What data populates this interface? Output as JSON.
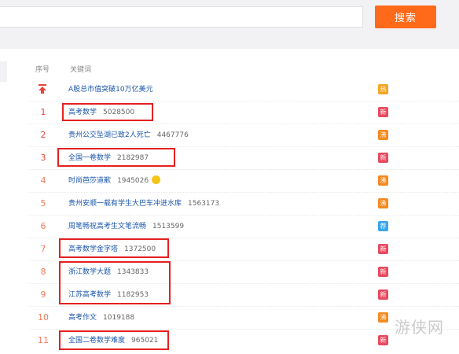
{
  "search": {
    "button_label": "搜索",
    "placeholder": ""
  },
  "table": {
    "col_num": "序号",
    "col_keyword": "关键词",
    "rows": [
      {
        "num": "",
        "keyword": "A股总市值突破10万亿美元",
        "count": "",
        "badge": "热",
        "badge_color": "#f5a623"
      },
      {
        "num": "1",
        "keyword": "高考数学",
        "count": "5028500",
        "badge": "新",
        "badge_color": "#e84a5f"
      },
      {
        "num": "2",
        "keyword": "贵州公交坠湖已致2人死亡",
        "count": "4467776",
        "badge": "沸",
        "badge_color": "#f58a1f"
      },
      {
        "num": "3",
        "keyword": "全国一卷数学",
        "count": "2182987",
        "badge": "新",
        "badge_color": "#e84a5f"
      },
      {
        "num": "4",
        "keyword": "时尚芭莎道歉",
        "count": "1945026",
        "badge": "沸",
        "badge_color": "#f58a1f"
      },
      {
        "num": "5",
        "keyword": "贵州安顺一载有学生大巴车冲进水库",
        "count": "1563173",
        "badge": "沸",
        "badge_color": "#f58a1f"
      },
      {
        "num": "6",
        "keyword": "周笔畅祝高考生文笔流畅",
        "count": "1513599",
        "badge": "荐",
        "badge_color": "#3aa6ea"
      },
      {
        "num": "7",
        "keyword": "高考数学金字塔",
        "count": "1372500",
        "badge": "新",
        "badge_color": "#e84a5f"
      },
      {
        "num": "8",
        "keyword": "浙江数学大题",
        "count": "1343833",
        "badge": "新",
        "badge_color": "#e84a5f"
      },
      {
        "num": "9",
        "keyword": "江苏高考数学",
        "count": "1182953",
        "badge": "新",
        "badge_color": "#e84a5f"
      },
      {
        "num": "10",
        "keyword": "高考作文",
        "count": "1019188",
        "badge": "沸",
        "badge_color": "#f58a1f"
      },
      {
        "num": "11",
        "keyword": "全国二卷数学难度",
        "count": "965021",
        "badge": "新",
        "badge_color": "#e84a5f"
      }
    ]
  },
  "watermark": "游侠网",
  "colors": {
    "accent": "#ff6a1a",
    "rank": "#e8443a",
    "highlight": "#e62020",
    "link": "#1a56a8"
  }
}
